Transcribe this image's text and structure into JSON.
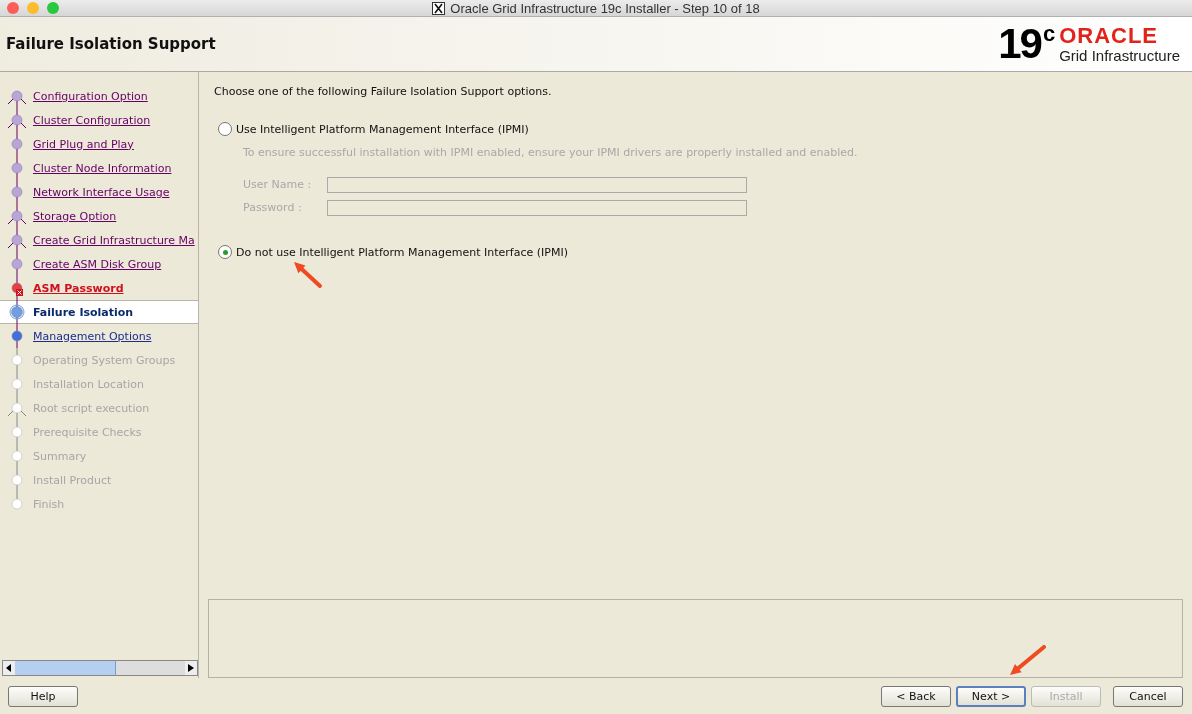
{
  "window": {
    "title": "Oracle Grid Infrastructure 19c Installer - Step 10 of 18"
  },
  "header": {
    "title": "Failure Isolation Support",
    "logo_version": "19",
    "logo_superscript": "c",
    "logo_brand": "ORACLE",
    "logo_product": "Grid Infrastructure"
  },
  "steps": [
    {
      "label": "Configuration Option",
      "kind": "visited",
      "fork": true,
      "selected": false
    },
    {
      "label": "Cluster Configuration",
      "kind": "visited",
      "fork": true,
      "selected": false
    },
    {
      "label": "Grid Plug and Play",
      "kind": "visited",
      "fork": false,
      "selected": false
    },
    {
      "label": "Cluster Node Information",
      "kind": "visited",
      "fork": false,
      "selected": false
    },
    {
      "label": "Network Interface Usage",
      "kind": "visited",
      "fork": false,
      "selected": false
    },
    {
      "label": "Storage Option",
      "kind": "visited",
      "fork": true,
      "selected": false
    },
    {
      "label": "Create Grid Infrastructure Ma",
      "kind": "visited",
      "fork": true,
      "selected": false
    },
    {
      "label": "Create ASM Disk Group",
      "kind": "visited",
      "fork": false,
      "selected": false
    },
    {
      "label": "ASM Password",
      "kind": "error",
      "fork": false,
      "selected": false
    },
    {
      "label": "Failure Isolation",
      "kind": "current",
      "fork": false,
      "selected": true
    },
    {
      "label": "Management Options",
      "kind": "next",
      "fork": false,
      "selected": false
    },
    {
      "label": "Operating System Groups",
      "kind": "pending",
      "fork": false,
      "selected": false
    },
    {
      "label": "Installation Location",
      "kind": "pending",
      "fork": false,
      "selected": false
    },
    {
      "label": "Root script execution",
      "kind": "pending",
      "fork": true,
      "selected": false
    },
    {
      "label": "Prerequisite Checks",
      "kind": "pending",
      "fork": false,
      "selected": false
    },
    {
      "label": "Summary",
      "kind": "pending",
      "fork": false,
      "selected": false
    },
    {
      "label": "Install Product",
      "kind": "pending",
      "fork": false,
      "selected": false
    },
    {
      "label": "Finish",
      "kind": "pending",
      "fork": false,
      "selected": false
    }
  ],
  "content": {
    "instruction": "Choose one of the following Failure Isolation Support options.",
    "options": [
      {
        "label": "Use Intelligent Platform Management Interface (IPMI)",
        "selected": false,
        "details": {
          "disabled": true,
          "note": "To ensure successful installation with IPMI enabled, ensure your IPMI drivers are properly installed and enabled.",
          "fields": [
            {
              "label": "User Name :"
            },
            {
              "label": "Password :"
            }
          ]
        }
      },
      {
        "label": "Do not use Intelligent Platform Management Interface (IPMI)",
        "selected": true
      }
    ]
  },
  "buttons": [
    {
      "label": "Help",
      "kind": "help",
      "disabled": false,
      "default": false
    },
    {
      "label": "< Back",
      "kind": "nav",
      "disabled": false,
      "default": false
    },
    {
      "label": "Next >",
      "kind": "nav",
      "disabled": false,
      "default": true
    },
    {
      "label": "Install",
      "kind": "nav",
      "disabled": true,
      "default": false
    },
    {
      "label": "Cancel",
      "kind": "cancel",
      "disabled": false,
      "default": false
    }
  ],
  "annotations": [
    {
      "kind": "arrow",
      "color": "#ee4b22"
    },
    {
      "kind": "arrow",
      "color": "#ee4b22"
    }
  ]
}
